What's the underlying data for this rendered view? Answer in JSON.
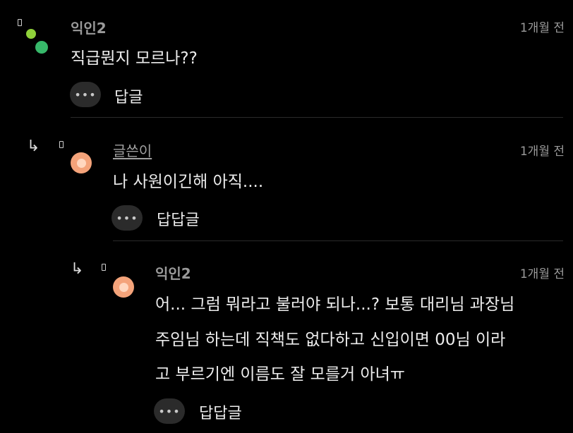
{
  "colors": {
    "background": "#000000",
    "dot_light_green": "#8fd13a",
    "dot_green": "#37b86a",
    "avatar_peach": "#f4a37a"
  },
  "comments": [
    {
      "author": "익인2",
      "time": "1개월 전",
      "body_lines": [
        "직급뭔지 모르나??"
      ],
      "more_label": "•••",
      "reply_label": "답글"
    },
    {
      "author": "글쓴이",
      "time": "1개월 전",
      "body_lines": [
        "나 사원이긴해 아직...."
      ],
      "more_label": "•••",
      "reply_label": "답답글"
    },
    {
      "author": "익인2",
      "time": "1개월 전",
      "body_lines": [
        "어... 그럼 뭐라고 불러야 되나...? 보통 대리님 과장님",
        "주임님 하는데 직책도 없다하고 신입이면 00님 이라",
        "고 부르기엔 이름도 잘 모를거 아녀ㅠ"
      ],
      "more_label": "•••",
      "reply_label": "답답글"
    }
  ],
  "icons": {
    "pin": "pin-icon",
    "reply_arrow": "reply-arrow-icon",
    "more": "more-icon"
  }
}
